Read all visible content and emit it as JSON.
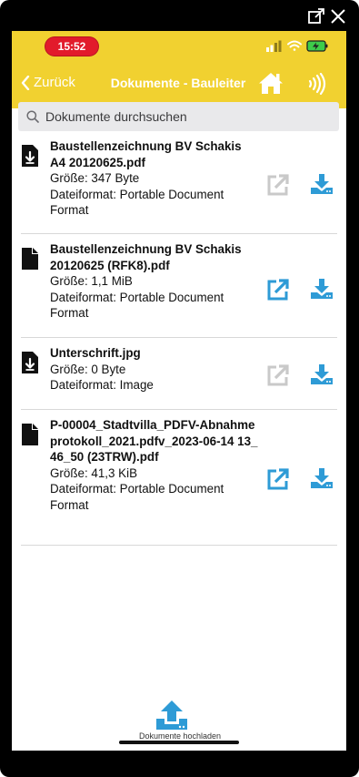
{
  "status_bar": {
    "time": "15:52"
  },
  "nav": {
    "back_label": "Zurück",
    "title": "Dokumente - Bauleiter"
  },
  "search": {
    "placeholder": "Dokumente durchsuchen"
  },
  "documents": [
    {
      "name": "Baustellenzeichnung BV Schakis A4 20120625.pdf",
      "size": "Größe: 347 Byte",
      "format": "Dateiformat: Portable Document Format",
      "downloaded": true,
      "open_enabled": false
    },
    {
      "name": "Baustellenzeichnung BV Schakis 20120625 (RFK8).pdf",
      "size": "Größe: 1,1 MiB",
      "format": "Dateiformat: Portable Document Format",
      "downloaded": false,
      "open_enabled": true
    },
    {
      "name": "Unterschrift.jpg",
      "size": "Größe: 0 Byte",
      "format": "Dateiformat: Image",
      "downloaded": true,
      "open_enabled": false
    },
    {
      "name": "P-00004_Stadtvilla_PDFV-Abnahmeprotokoll_2021.pdfv_2023-06-14 13_46_50 (23TRW).pdf",
      "size": "Größe: 41,3 KiB",
      "format": "Dateiformat: Portable Document Format",
      "downloaded": false,
      "open_enabled": true
    }
  ],
  "upload": {
    "label": "Dokumente hochladen"
  },
  "colors": {
    "header": "#f1d130",
    "accent": "#2e9bd6",
    "disabled": "#c9c9c9",
    "time_pill": "#e21b2b"
  },
  "icons": {
    "window": [
      "external-window-icon",
      "close-icon"
    ],
    "nav": [
      "chevron-left-icon",
      "home-icon",
      "nfc-icon"
    ],
    "row": [
      "file-icon",
      "file-download-icon",
      "open-external-icon",
      "download-icon"
    ],
    "bottom": [
      "upload-icon"
    ]
  }
}
